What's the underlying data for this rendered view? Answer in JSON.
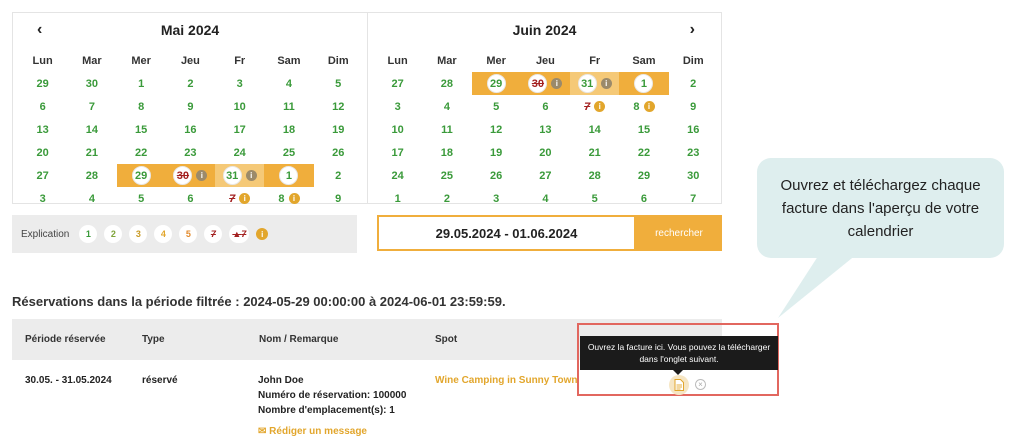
{
  "calendar_left": {
    "title": "Mai 2024",
    "prev_icon": "chevron-left-icon",
    "weekdays": [
      "Lun",
      "Mar",
      "Mer",
      "Jeu",
      "Fr",
      "Sam",
      "Dim"
    ],
    "weeks": [
      [
        "29",
        "30",
        "1",
        "2",
        "3",
        "4",
        "5"
      ],
      [
        "6",
        "7",
        "8",
        "9",
        "10",
        "11",
        "12"
      ],
      [
        "13",
        "14",
        "15",
        "16",
        "17",
        "18",
        "19"
      ],
      [
        "20",
        "21",
        "22",
        "23",
        "24",
        "25",
        "26"
      ],
      [
        "27",
        "28",
        "29",
        "30",
        "31",
        "1",
        "2"
      ],
      [
        "3",
        "4",
        "5",
        "6",
        "7",
        "8",
        "9"
      ]
    ]
  },
  "calendar_right": {
    "title": "Juin 2024",
    "next_icon": "chevron-right-icon",
    "weekdays": [
      "Lun",
      "Mar",
      "Mer",
      "Jeu",
      "Fr",
      "Sam",
      "Dim"
    ],
    "weeks": [
      [
        "27",
        "28",
        "29",
        "30",
        "31",
        "1",
        "2"
      ],
      [
        "3",
        "4",
        "5",
        "6",
        "7",
        "8",
        "9"
      ],
      [
        "10",
        "11",
        "12",
        "13",
        "14",
        "15",
        "16"
      ],
      [
        "17",
        "18",
        "19",
        "20",
        "21",
        "22",
        "23"
      ],
      [
        "24",
        "25",
        "26",
        "27",
        "28",
        "29",
        "30"
      ],
      [
        "1",
        "2",
        "3",
        "4",
        "5",
        "6",
        "7"
      ]
    ]
  },
  "legend": {
    "label": "Explication",
    "items": [
      "1",
      "2",
      "3",
      "4",
      "5"
    ],
    "struck": "7",
    "info_icon": "info-icon"
  },
  "search": {
    "range": "29.05.2024 - 01.06.2024",
    "button": "rechercher"
  },
  "callout": {
    "text": "Ouvrez et téléchargez chaque facture dans l'aperçu de votre calendrier"
  },
  "reservations": {
    "title": "Réservations dans la période filtrée : 2024-05-29 00:00:00 à 2024-06-01 23:59:59.",
    "columns": [
      "Période réservée",
      "Type",
      "Nom / Remarque",
      "Spot"
    ],
    "rows": [
      {
        "period": "30.05. - 31.05.2024",
        "type": "réservé",
        "name": "John Doe",
        "booking_number": "Numéro de réservation: 100000",
        "spots": "Nombre d'emplacement(s): 1",
        "spot": "Wine Camping in Sunny Town",
        "message_link": "Rédiger un message"
      }
    ]
  },
  "tooltip": {
    "text": "Ouvrez la facture ici. Vous pouvez la télécharger dans l'onglet suivant.",
    "invoice_icon": "document-icon",
    "close_icon": "close-circle-icon"
  },
  "colors": {
    "accent": "#f0ae3c",
    "available": "#3a9a3a",
    "blocked": "#a32020",
    "highlight": "#e2675f",
    "callout_bg": "#deeeee"
  }
}
